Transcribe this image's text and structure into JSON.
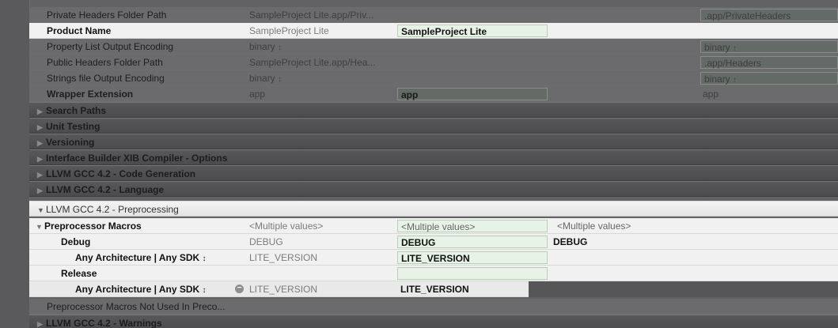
{
  "rows_top": [
    {
      "name": "Private Headers Folder Path",
      "default": "SampleProject Lite.app/Priv...",
      "project": "",
      "target": ".app/PrivateHeaders"
    },
    {
      "name": "Product Name",
      "default": "SampleProject Lite",
      "project": "SampleProject Lite",
      "target": ""
    },
    {
      "name": "Property List Output Encoding",
      "default": "binary",
      "project": "",
      "target": "binary"
    },
    {
      "name": "Public Headers Folder Path",
      "default": "SampleProject Lite.app/Hea...",
      "project": "",
      "target": ".app/Headers"
    },
    {
      "name": "Strings file Output Encoding",
      "default": "binary",
      "project": "",
      "target": "binary"
    },
    {
      "name": "Wrapper Extension",
      "default": "app",
      "project": "app",
      "target": "app"
    }
  ],
  "sections_collapsed": [
    "Search Paths",
    "Unit Testing",
    "Versioning",
    "Interface Builder XIB Compiler - Options",
    "LLVM GCC 4.2 - Code Generation",
    "LLVM GCC 4.2 - Language"
  ],
  "section_open": "LLVM GCC 4.2 - Preprocessing",
  "preproc": {
    "macros": {
      "name": "Preprocessor Macros",
      "default": "<Multiple values>",
      "project": "<Multiple values>",
      "target": "<Multiple values>"
    },
    "debug": {
      "name": "Debug",
      "default": "DEBUG",
      "project": "DEBUG",
      "target": "DEBUG"
    },
    "debug_arch": {
      "name": "Any Architecture | Any SDK",
      "default": "LITE_VERSION",
      "project": "LITE_VERSION"
    },
    "release": {
      "name": "Release"
    },
    "release_arch": {
      "name": "Any Architecture | Any SDK",
      "default": "LITE_VERSION",
      "project": "LITE_VERSION"
    }
  },
  "after": {
    "row": "Preprocessor Macros Not Used In Preco...",
    "section": "LLVM GCC 4.2 - Warnings"
  },
  "glyphs": {
    "stepper": "↕",
    "tri_closed": "▶",
    "tri_open": "▼",
    "minus": "−"
  },
  "colors": {
    "highlight": "#f1f1f1",
    "editable_field": "#e7f3e6",
    "dark_row": "#6b6b6d"
  }
}
